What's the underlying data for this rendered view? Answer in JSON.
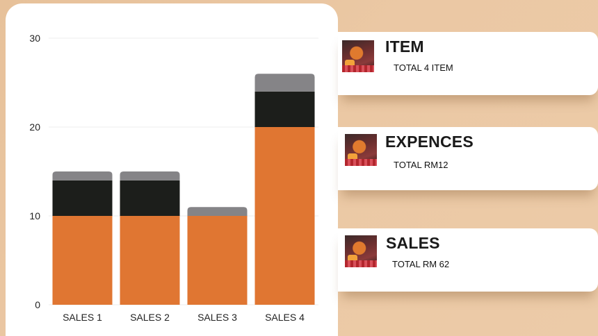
{
  "chart_data": {
    "type": "bar",
    "stacked": true,
    "categories": [
      "SALES 1",
      "SALES 2",
      "SALES 3",
      "SALES 4"
    ],
    "series": [
      {
        "color": "#e07632",
        "values": [
          10,
          10,
          10,
          20
        ]
      },
      {
        "color": "#1c1e1b",
        "values": [
          4,
          4,
          0,
          4
        ]
      },
      {
        "color": "#858487",
        "values": [
          1,
          1,
          1,
          2
        ]
      }
    ],
    "yticks": [
      "0",
      "10",
      "20",
      "30"
    ],
    "ylim": [
      0,
      30
    ],
    "grid": true,
    "legend": "none"
  },
  "cards": [
    {
      "title": "ITEM",
      "subtitle": "TOTAL 4 ITEM",
      "icon": "food-photo-icon"
    },
    {
      "title": "EXPENCES",
      "subtitle": "TOTAL RM12",
      "icon": "food-photo-icon"
    },
    {
      "title": "SALES",
      "subtitle": "TOTAL RM 62",
      "icon": "food-photo-icon"
    }
  ]
}
